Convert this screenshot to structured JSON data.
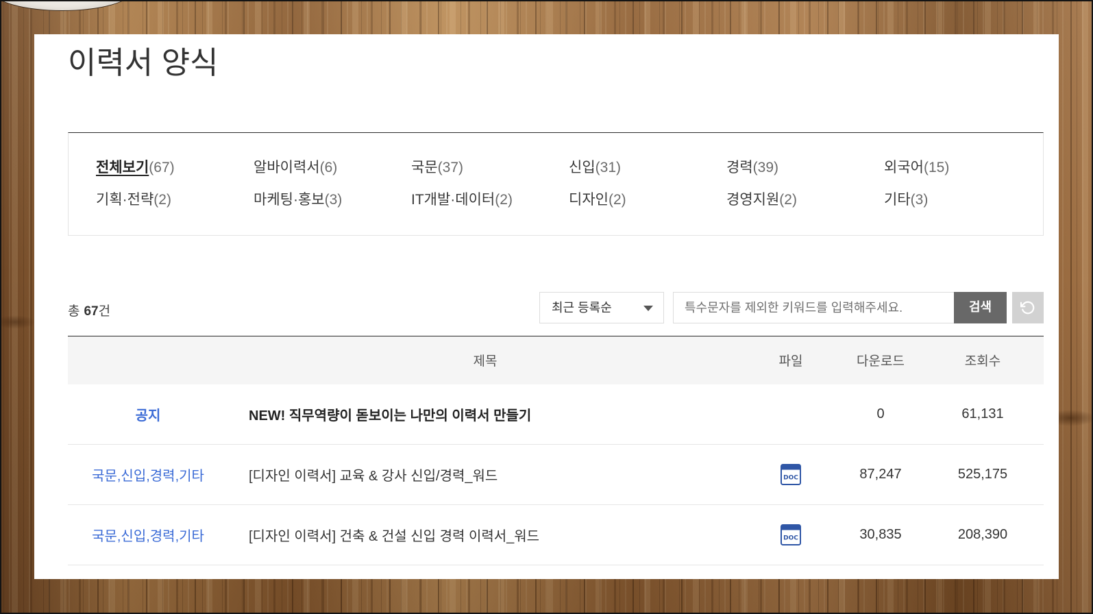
{
  "page": {
    "title": "이력서 양식"
  },
  "categories": [
    {
      "label": "전체보기",
      "count": "(67)",
      "active": true
    },
    {
      "label": "알바이력서",
      "count": "(6)"
    },
    {
      "label": "국문",
      "count": "(37)"
    },
    {
      "label": "신입",
      "count": "(31)"
    },
    {
      "label": "경력",
      "count": "(39)"
    },
    {
      "label": "외국어",
      "count": "(15)"
    },
    {
      "label": "기획·전략",
      "count": "(2)"
    },
    {
      "label": "마케팅·홍보",
      "count": "(3)"
    },
    {
      "label": "IT개발·데이터",
      "count": "(2)"
    },
    {
      "label": "디자인",
      "count": "(2)"
    },
    {
      "label": "경영지원",
      "count": "(2)"
    },
    {
      "label": "기타",
      "count": "(3)"
    }
  ],
  "list_toolbar": {
    "total_label": "총",
    "total_count": "67",
    "total_unit": "건",
    "sort_selected": "최근 등록순",
    "sort_icon": "caret-down-icon",
    "search_placeholder": "특수문자를 제외한 키워드를 입력해주세요.",
    "search_button_label": "검색",
    "reset_icon": "refresh-icon"
  },
  "table": {
    "headers": {
      "title": "제목",
      "file": "파일",
      "downloads": "다운로드",
      "views": "조회수"
    },
    "rows": [
      {
        "category": "공지",
        "title": "NEW! 직무역량이 돋보이는 나만의 이력서 만들기",
        "downloads": "0",
        "views": "61,131",
        "notice": true
      },
      {
        "category": "국문,신입,경력,기타",
        "title": "[디자인 이력서] 교육 & 강사 신입/경력_워드",
        "file_icon": "doc-icon",
        "file_icon_text": "DOC",
        "downloads": "87,247",
        "views": "525,175"
      },
      {
        "category": "국문,신입,경력,기타",
        "title": "[디자인 이력서] 건축 & 건설 신입 경력 이력서_워드",
        "file_icon": "doc-icon",
        "file_icon_text": "DOC",
        "downloads": "30,835",
        "views": "208,390"
      }
    ]
  },
  "colors": {
    "accent": "#3b6bd6",
    "search_button_bg": "#686868",
    "reset_button_bg": "#d2d2d2",
    "doc_icon": "#2f56a6",
    "header_bg": "#f5f5f5"
  }
}
